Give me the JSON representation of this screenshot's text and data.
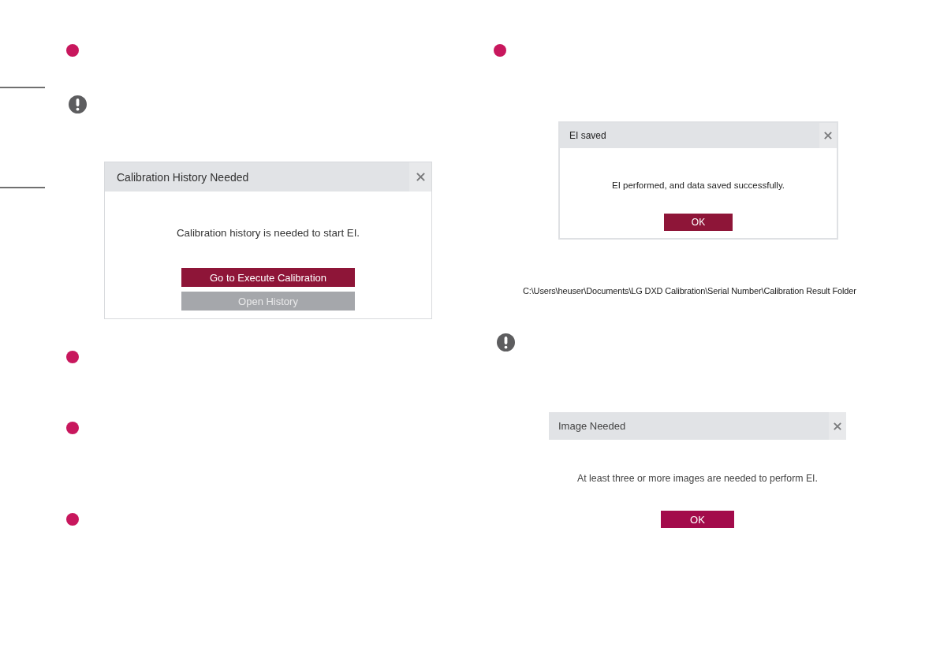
{
  "left_column": [
    {
      "kind": "step"
    },
    {
      "kind": "note"
    },
    {
      "kind": "dialog",
      "title": "Calibration History Needed",
      "message": "Calibration history is needed to start EI.",
      "buttons": [
        {
          "label": "Go to Execute Calibration",
          "disabled": false
        },
        {
          "label": "Open History",
          "disabled": true
        }
      ]
    },
    {
      "kind": "step"
    },
    {
      "kind": "step"
    },
    {
      "kind": "step"
    }
  ],
  "right_column": [
    {
      "kind": "step"
    },
    {
      "kind": "dialog",
      "title": "EI saved",
      "message": "EI performed, and data saved successfully.",
      "buttons": [
        {
          "label": "OK",
          "disabled": false
        }
      ]
    },
    {
      "kind": "path",
      "text": "C:\\Users\\heuser\\Documents\\LG DXD Calibration\\Serial Number\\Calibration Result Folder"
    },
    {
      "kind": "note"
    },
    {
      "kind": "dialog",
      "title": "Image Needed",
      "message": "At least three or more images are needed to perform EI.",
      "buttons": [
        {
          "label": "OK",
          "disabled": false
        }
      ]
    }
  ]
}
